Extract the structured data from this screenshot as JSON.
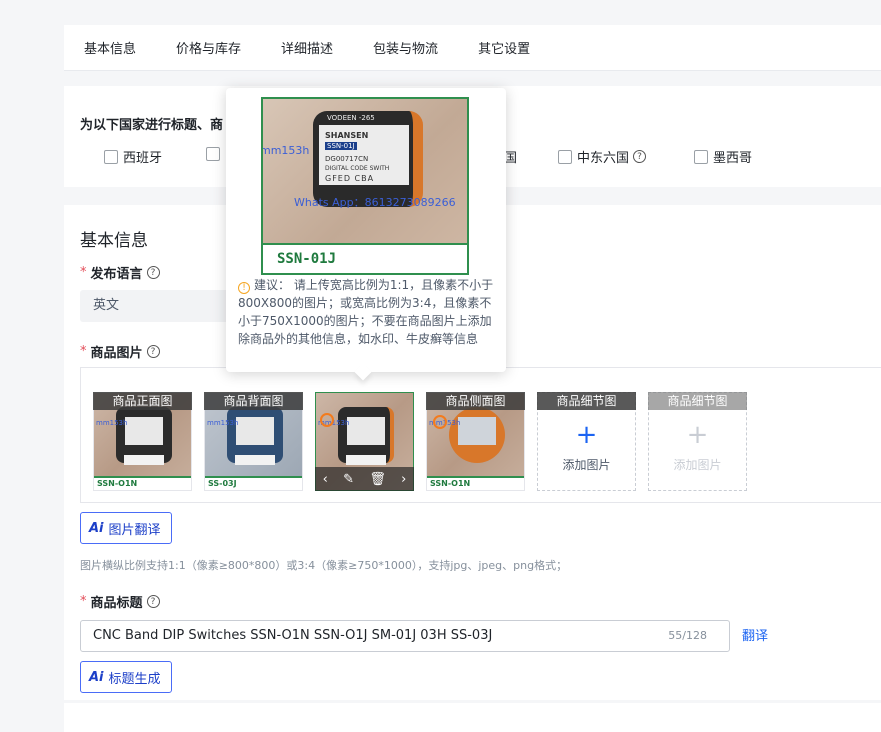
{
  "tabs": [
    "基本信息",
    "价格与库存",
    "详细描述",
    "包装与物流",
    "其它设置"
  ],
  "countries": {
    "title": "为以下国家进行标题、商",
    "items": [
      {
        "label": "西班牙",
        "checked": false
      },
      {
        "label": "",
        "checked": false
      },
      {
        "label": "国",
        "checked": false
      },
      {
        "label": "中东六国",
        "checked": false
      },
      {
        "label": "墨西哥",
        "checked": false
      }
    ]
  },
  "basic": {
    "section_title": "基本信息",
    "language_label": "发布语言",
    "language_value": "英文",
    "images_label": "商品图片",
    "image_slots": [
      {
        "caption": "商品正面图",
        "code": "SSN-O1N",
        "watermark": "mm153h"
      },
      {
        "caption": "商品背面图",
        "code": "SS-03J",
        "watermark": "mm153h"
      },
      {
        "caption": "",
        "code": "",
        "watermark": "mm153h"
      },
      {
        "caption": "商品侧面图",
        "code": "SSN-O1N",
        "watermark": "mm153h"
      },
      {
        "caption": "商品细节图",
        "add_text": "添加图片"
      },
      {
        "caption": "商品细节图",
        "add_text": "添加图片"
      }
    ],
    "image_translate_button": "图片翻译",
    "image_hint": "图片横纵比例支持1:1（像素≥800*800）或3:4（像素≥750*1000），支持jpg、jpeg、png格式；",
    "title_label": "商品标题",
    "title_value": "CNC Band DIP Switches SSN-O1N SSN-O1J SM-01J 03H SS-03J",
    "title_counter": "55/128",
    "translate_link": "翻译",
    "title_generate_button": "标题生成",
    "ai_mark": "Ai",
    "star": "*",
    "help_mark": "?",
    "plus": "+",
    "tools": [
      "‹",
      "✎",
      "🗑",
      "›"
    ]
  },
  "popover": {
    "image_code": "SSN-01J",
    "label_lines": [
      "VODEEN -265",
      "SHANSEN",
      "SSN-01J",
      "DG00717CN",
      "DIGITAL CODE SWITH",
      "GFED  CBA"
    ],
    "watermark_1": "mm153h",
    "watermark_2": "Whats App：8613273089266",
    "tip_icon": "!",
    "tip_text": "建议： 请上传宽高比例为1:1，且像素不小于800X800的图片；或宽高比例为3:4，且像素不小于750X1000的图片；不要在商品图片上添加除商品外的其他信息，如水印、牛皮癣等信息"
  }
}
